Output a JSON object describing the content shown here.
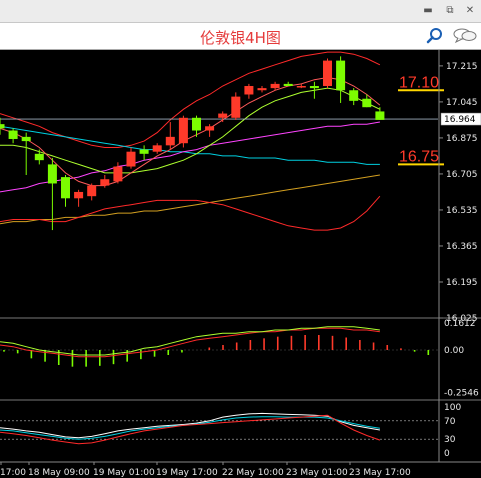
{
  "window": {
    "minimize_icon": "minimize-icon",
    "restore_icon": "restore-icon",
    "close_icon": "close-icon"
  },
  "toolbar": {
    "title": "伦敦银4H图",
    "search_icon": "search-icon",
    "chat_icon": "chat-icon"
  },
  "colors": {
    "title": "#e53b3b",
    "bull_candle": "#ff3a2a",
    "bear_candle": "#7cfc00",
    "bands": "#ff2a2a",
    "fast_ma": "#ff5a5a",
    "mid_ma": "#adff2f",
    "slow_ma": "#00cfe0",
    "ma_purple": "#ff44ff",
    "ma_long": "#d4a020",
    "level_line": "#ffd700",
    "level_text": "#ff3a2a"
  },
  "chart_data": [
    {
      "type": "candlestick",
      "name": "price",
      "yticks": [
        "17.215",
        "17.045",
        "16.875",
        "16.705",
        "16.535",
        "16.365",
        "16.195",
        "16.025"
      ],
      "ylim": [
        16.025,
        17.29
      ],
      "current_price": "16.964",
      "levels": [
        {
          "label": "17.10",
          "value": 17.1
        },
        {
          "label": "16.75",
          "value": 16.75
        }
      ],
      "candles": [
        {
          "o": 16.94,
          "h": 16.97,
          "l": 16.89,
          "c": 16.92
        },
        {
          "o": 16.91,
          "h": 16.92,
          "l": 16.85,
          "c": 16.87
        },
        {
          "o": 16.88,
          "h": 16.9,
          "l": 16.7,
          "c": 16.86
        },
        {
          "o": 16.8,
          "h": 16.82,
          "l": 16.75,
          "c": 16.77
        },
        {
          "o": 16.75,
          "h": 16.78,
          "l": 16.44,
          "c": 16.66
        },
        {
          "o": 16.69,
          "h": 16.7,
          "l": 16.55,
          "c": 16.59
        },
        {
          "o": 16.59,
          "h": 16.63,
          "l": 16.55,
          "c": 16.62
        },
        {
          "o": 16.6,
          "h": 16.66,
          "l": 16.58,
          "c": 16.65
        },
        {
          "o": 16.65,
          "h": 16.7,
          "l": 16.64,
          "c": 16.68
        },
        {
          "o": 16.67,
          "h": 16.76,
          "l": 16.66,
          "c": 16.74
        },
        {
          "o": 16.74,
          "h": 16.83,
          "l": 16.73,
          "c": 16.81
        },
        {
          "o": 16.82,
          "h": 16.84,
          "l": 16.77,
          "c": 16.8
        },
        {
          "o": 16.81,
          "h": 16.85,
          "l": 16.8,
          "c": 16.84
        },
        {
          "o": 16.84,
          "h": 16.95,
          "l": 16.82,
          "c": 16.88
        },
        {
          "o": 16.85,
          "h": 16.98,
          "l": 16.83,
          "c": 16.97
        },
        {
          "o": 16.97,
          "h": 16.98,
          "l": 16.88,
          "c": 16.91
        },
        {
          "o": 16.91,
          "h": 16.94,
          "l": 16.88,
          "c": 16.93
        },
        {
          "o": 16.97,
          "h": 17.0,
          "l": 16.95,
          "c": 16.99
        },
        {
          "o": 16.97,
          "h": 17.09,
          "l": 16.96,
          "c": 17.07
        },
        {
          "o": 17.08,
          "h": 17.13,
          "l": 17.06,
          "c": 17.12
        },
        {
          "o": 17.1,
          "h": 17.12,
          "l": 17.09,
          "c": 17.11
        },
        {
          "o": 17.11,
          "h": 17.14,
          "l": 17.1,
          "c": 17.13
        },
        {
          "o": 17.13,
          "h": 17.14,
          "l": 17.12,
          "c": 17.12
        },
        {
          "o": 17.12,
          "h": 17.13,
          "l": 17.11,
          "c": 17.12
        },
        {
          "o": 17.12,
          "h": 17.14,
          "l": 17.06,
          "c": 17.11
        },
        {
          "o": 17.12,
          "h": 17.25,
          "l": 17.11,
          "c": 17.24
        },
        {
          "o": 17.24,
          "h": 17.26,
          "l": 17.04,
          "c": 17.1
        },
        {
          "o": 17.1,
          "h": 17.11,
          "l": 17.03,
          "c": 17.05
        },
        {
          "o": 17.06,
          "h": 17.08,
          "l": 17.02,
          "c": 17.02
        },
        {
          "o": 17.0,
          "h": 17.02,
          "l": 16.96,
          "c": 16.96
        }
      ],
      "indicators": {
        "upper_band": [
          16.99,
          16.97,
          16.95,
          16.93,
          16.9,
          16.88,
          16.86,
          16.84,
          16.83,
          16.83,
          16.84,
          16.86,
          16.9,
          16.96,
          17.01,
          17.05,
          17.08,
          17.12,
          17.15,
          17.18,
          17.2,
          17.22,
          17.24,
          17.26,
          17.27,
          17.28,
          17.28,
          17.27,
          17.25,
          17.22
        ],
        "lower_band": [
          16.48,
          16.49,
          16.49,
          16.49,
          16.48,
          16.48,
          16.5,
          16.52,
          16.54,
          16.55,
          16.56,
          16.57,
          16.58,
          16.58,
          16.58,
          16.58,
          16.57,
          16.56,
          16.54,
          16.52,
          16.5,
          16.48,
          16.46,
          16.45,
          16.44,
          16.44,
          16.45,
          16.48,
          16.53,
          16.6
        ],
        "fast_ma": [
          16.92,
          16.9,
          16.87,
          16.83,
          16.77,
          16.71,
          16.67,
          16.65,
          16.65,
          16.67,
          16.71,
          16.75,
          16.79,
          16.82,
          16.86,
          16.89,
          16.92,
          16.96,
          17.0,
          17.04,
          17.07,
          17.1,
          17.12,
          17.13,
          17.15,
          17.16,
          17.15,
          17.12,
          17.08,
          17.03
        ],
        "mid_ma": [
          16.84,
          16.84,
          16.83,
          16.81,
          16.79,
          16.77,
          16.75,
          16.73,
          16.71,
          16.71,
          16.71,
          16.72,
          16.73,
          16.75,
          16.77,
          16.8,
          16.84,
          16.88,
          16.93,
          16.98,
          17.02,
          17.05,
          17.07,
          17.09,
          17.1,
          17.11,
          17.1,
          17.07,
          17.04,
          17.01
        ],
        "slow_ma": [
          16.93,
          16.92,
          16.91,
          16.9,
          16.89,
          16.88,
          16.87,
          16.86,
          16.85,
          16.84,
          16.83,
          16.82,
          16.82,
          16.81,
          16.81,
          16.8,
          16.8,
          16.79,
          16.79,
          16.78,
          16.78,
          16.78,
          16.77,
          16.77,
          16.77,
          16.76,
          16.76,
          16.76,
          16.75,
          16.75
        ],
        "ma_purple": [
          16.62,
          16.63,
          16.64,
          16.66,
          16.67,
          16.68,
          16.69,
          16.71,
          16.72,
          16.74,
          16.75,
          16.77,
          16.78,
          16.79,
          16.81,
          16.82,
          16.84,
          16.85,
          16.86,
          16.87,
          16.88,
          16.89,
          16.9,
          16.91,
          16.92,
          16.93,
          16.93,
          16.94,
          16.94,
          16.95
        ],
        "ma_long": [
          16.47,
          16.48,
          16.48,
          16.49,
          16.49,
          16.5,
          16.5,
          16.51,
          16.51,
          16.52,
          16.52,
          16.53,
          16.53,
          16.54,
          16.55,
          16.56,
          16.57,
          16.58,
          16.59,
          16.6,
          16.61,
          16.62,
          16.63,
          16.64,
          16.65,
          16.66,
          16.67,
          16.68,
          16.69,
          16.7
        ]
      }
    },
    {
      "type": "bar",
      "name": "macd",
      "yticks": [
        "0.1612",
        "0.00",
        "-0.2546"
      ],
      "ylim": [
        -0.3,
        0.18
      ],
      "histogram": [
        -0.01,
        -0.02,
        -0.05,
        -0.07,
        -0.09,
        -0.1,
        -0.1,
        -0.095,
        -0.085,
        -0.07,
        -0.055,
        -0.04,
        -0.03,
        -0.015,
        0.0,
        0.015,
        0.03,
        0.045,
        0.06,
        0.07,
        0.08,
        0.085,
        0.09,
        0.09,
        0.085,
        0.075,
        0.06,
        0.045,
        0.03,
        0.01,
        -0.01,
        -0.03
      ],
      "signal": [
        0.03,
        0.02,
        0.0,
        -0.01,
        -0.02,
        -0.03,
        -0.04,
        -0.04,
        -0.04,
        -0.03,
        -0.02,
        -0.01,
        0.0,
        0.02,
        0.04,
        0.06,
        0.07,
        0.08,
        0.09,
        0.1,
        0.11,
        0.11,
        0.12,
        0.12,
        0.13,
        0.13,
        0.13,
        0.12,
        0.12,
        0.11
      ],
      "macd_line": [
        0.05,
        0.04,
        0.02,
        0.0,
        -0.01,
        -0.02,
        -0.03,
        -0.03,
        -0.03,
        -0.02,
        -0.01,
        0.01,
        0.02,
        0.04,
        0.06,
        0.08,
        0.09,
        0.1,
        0.1,
        0.11,
        0.11,
        0.12,
        0.12,
        0.13,
        0.13,
        0.14,
        0.14,
        0.14,
        0.13,
        0.12
      ]
    },
    {
      "type": "line",
      "name": "oscillator",
      "yticks": [
        "100",
        "70",
        "30",
        "0"
      ],
      "ylim": [
        0,
        100
      ],
      "levels": [
        70,
        30
      ],
      "series": [
        {
          "values": [
            55,
            52,
            48,
            45,
            40,
            35,
            33,
            36,
            42,
            48,
            52,
            55,
            58,
            60,
            62,
            65,
            70,
            78,
            82,
            85,
            86,
            85,
            84,
            83,
            82,
            80,
            68,
            60,
            55,
            50
          ]
        },
        {
          "values": [
            50,
            48,
            44,
            40,
            36,
            32,
            30,
            32,
            36,
            42,
            48,
            52,
            55,
            58,
            60,
            63,
            67,
            72,
            76,
            78,
            79,
            79,
            78,
            78,
            78,
            76,
            70,
            64,
            58,
            54
          ]
        },
        {
          "values": [
            45,
            42,
            38,
            33,
            28,
            24,
            20,
            22,
            28,
            35,
            42,
            48,
            52,
            56,
            60,
            62,
            64,
            66,
            68,
            70,
            72,
            74,
            76,
            78,
            80,
            82,
            65,
            50,
            38,
            28
          ]
        }
      ]
    }
  ],
  "time_axis": {
    "labels": [
      "17:00",
      "18 May 09:00",
      "19 May 01:00",
      "19 May 17:00",
      "22 May 10:00",
      "23 May 01:00",
      "23 May 17:00"
    ]
  }
}
